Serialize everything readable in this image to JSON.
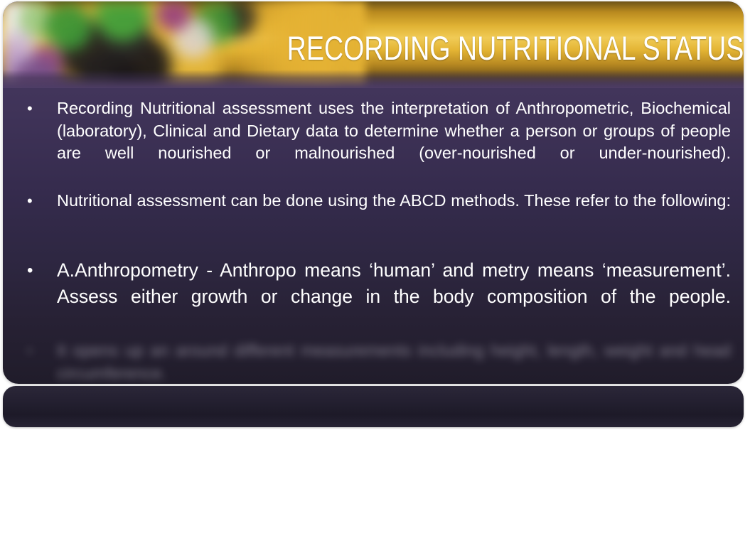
{
  "slide": {
    "title": "RECORDING NUTRITIONAL STATUS",
    "header_image_alt": "blurred fruit and vegetable photo banner",
    "colors": {
      "banner_gold": "#e4b534",
      "panel_purple": "#3f3358",
      "panel_dark": "#201c2a",
      "bottom_bar": "#241f30",
      "text": "#ffffff"
    }
  },
  "body": {
    "bullets": [
      {
        "id": "bullet-assessment-definition",
        "text": "Recording Nutritional assessment uses the interpretation of Anthropometric, Biochemical (laboratory), Clinical and Dietary data to determine whether a person or groups of people are well nourished or malnourished (over-nourished or under-nourished).",
        "style": "normal"
      },
      {
        "id": "bullet-abcd-methods",
        "text": "Nutritional assessment can be done using the ABCD methods. These refer to the following:",
        "style": "normal"
      },
      {
        "id": "bullet-anthropometry",
        "text": "A.Anthropometry - Anthropo means ‘human’ and metry means ‘measurement’. Assess either growth or change in the body composition of the people.",
        "style": "large"
      },
      {
        "id": "bullet-obscured",
        "text": "It opens up an around different measurements including height, length, weight and head circumference.",
        "style": "blurred"
      }
    ]
  }
}
